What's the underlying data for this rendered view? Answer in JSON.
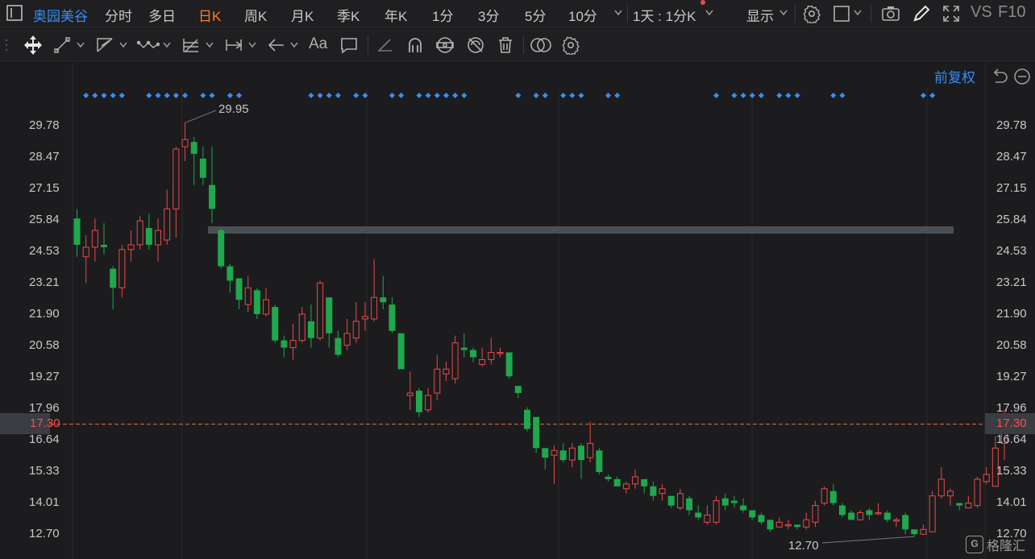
{
  "toolbar": {
    "stock_name": "奥园美谷",
    "periods": [
      "分时",
      "多日",
      "日K",
      "周K",
      "月K",
      "季K",
      "年K",
      "1分",
      "3分",
      "5分",
      "10分"
    ],
    "active_period": "日K",
    "interval_selector": "1天 : 1分K",
    "display_label": "显示",
    "vs_label": "VS",
    "f10_label": "F10"
  },
  "chart": {
    "restore_label": "前复权",
    "y_ticks": [
      "29.78",
      "28.47",
      "27.15",
      "25.84",
      "24.53",
      "23.21",
      "21.90",
      "20.58",
      "19.27",
      "17.96",
      "16.64",
      "15.33",
      "14.01",
      "12.70"
    ],
    "current_price": "17.30",
    "high_label": "29.95",
    "low_label": "12.70",
    "watermark": "格隆汇",
    "up_color": "#e84a4a",
    "down_color": "#1fa84d",
    "marker_color": "#3b8cf0"
  },
  "chart_data": {
    "type": "candlestick",
    "ylim": [
      12.2,
      30.6
    ],
    "candles": [
      [
        25.9,
        24.8,
        26.3,
        24.3
      ],
      [
        24.3,
        24.7,
        25.2,
        23.2
      ],
      [
        24.7,
        25.4,
        25.9,
        24.1
      ],
      [
        24.8,
        24.7,
        25.7,
        24.4
      ],
      [
        23.8,
        23.0,
        23.9,
        22.1
      ],
      [
        23.0,
        24.6,
        24.8,
        22.6
      ],
      [
        24.6,
        24.8,
        25.4,
        24.1
      ],
      [
        24.8,
        25.8,
        26.0,
        24.6
      ],
      [
        25.5,
        24.8,
        26.1,
        24.6
      ],
      [
        24.8,
        25.4,
        25.9,
        24.1
      ],
      [
        25.0,
        26.3,
        27.1,
        24.8
      ],
      [
        26.3,
        28.8,
        28.9,
        25.1
      ],
      [
        28.9,
        29.2,
        29.9,
        28.3
      ],
      [
        29.1,
        28.6,
        29.3,
        27.3
      ],
      [
        28.4,
        27.6,
        28.9,
        27.3
      ],
      [
        27.3,
        26.3,
        28.9,
        25.7
      ],
      [
        25.4,
        23.9,
        25.5,
        23.8
      ],
      [
        23.9,
        23.3,
        24.0,
        22.8
      ],
      [
        23.4,
        22.5,
        23.4,
        22.1
      ],
      [
        22.3,
        23.0,
        23.5,
        22.0
      ],
      [
        22.9,
        21.9,
        23.0,
        21.7
      ],
      [
        21.9,
        22.5,
        23.0,
        21.8
      ],
      [
        22.2,
        20.8,
        22.3,
        20.7
      ],
      [
        20.8,
        20.5,
        21.0,
        20.1
      ],
      [
        20.5,
        20.8,
        21.5,
        20.0
      ],
      [
        20.8,
        21.9,
        22.2,
        20.7
      ],
      [
        21.6,
        20.9,
        22.3,
        20.5
      ],
      [
        20.9,
        23.2,
        23.3,
        20.8
      ],
      [
        22.6,
        21.1,
        22.6,
        20.5
      ],
      [
        20.9,
        20.2,
        21.2,
        20.1
      ],
      [
        20.6,
        21.1,
        21.7,
        20.4
      ],
      [
        20.9,
        21.6,
        22.4,
        20.7
      ],
      [
        21.7,
        21.8,
        22.4,
        21.2
      ],
      [
        21.7,
        22.6,
        24.2,
        21.6
      ],
      [
        22.6,
        22.4,
        23.5,
        22.1
      ],
      [
        22.3,
        21.2,
        22.6,
        21.1
      ],
      [
        21.1,
        19.6,
        21.1,
        19.6
      ],
      [
        18.5,
        18.6,
        19.5,
        17.9
      ],
      [
        18.7,
        17.8,
        18.8,
        17.6
      ],
      [
        17.9,
        18.5,
        18.8,
        17.8
      ],
      [
        18.6,
        19.6,
        20.2,
        18.3
      ],
      [
        19.4,
        19.6,
        19.9,
        19.1
      ],
      [
        19.2,
        20.7,
        21.0,
        19.0
      ],
      [
        20.5,
        20.4,
        21.1,
        20.1
      ],
      [
        20.4,
        20.1,
        20.5,
        19.9
      ],
      [
        19.8,
        20.0,
        20.5,
        19.7
      ],
      [
        20.0,
        20.3,
        20.9,
        19.8
      ],
      [
        20.3,
        20.3,
        20.5,
        20.1
      ],
      [
        20.3,
        19.3,
        20.3,
        19.2
      ],
      [
        18.9,
        18.6,
        18.9,
        18.4
      ],
      [
        17.9,
        17.1,
        18.0,
        17.0
      ],
      [
        17.6,
        16.3,
        17.6,
        16.1
      ],
      [
        16.3,
        15.9,
        16.3,
        15.4
      ],
      [
        16.0,
        16.2,
        16.4,
        14.8
      ],
      [
        16.2,
        15.8,
        16.5,
        15.7
      ],
      [
        15.8,
        16.3,
        16.5,
        15.5
      ],
      [
        16.4,
        15.8,
        16.5,
        15.0
      ],
      [
        15.9,
        16.5,
        17.4,
        15.7
      ],
      [
        16.2,
        15.3,
        16.3,
        15.2
      ],
      [
        15.1,
        15.0,
        15.2,
        14.9
      ],
      [
        15.0,
        14.7,
        15.1,
        14.7
      ],
      [
        14.6,
        14.8,
        14.9,
        14.4
      ],
      [
        14.8,
        15.1,
        15.4,
        14.6
      ],
      [
        15.0,
        14.7,
        15.0,
        14.4
      ],
      [
        14.7,
        14.3,
        14.9,
        14.1
      ],
      [
        14.4,
        14.6,
        14.8,
        14.1
      ],
      [
        14.3,
        13.9,
        14.3,
        13.8
      ],
      [
        13.8,
        14.4,
        14.6,
        13.7
      ],
      [
        14.2,
        13.7,
        14.3,
        13.5
      ],
      [
        13.6,
        13.4,
        13.9,
        13.3
      ],
      [
        13.2,
        13.5,
        13.9,
        13.1
      ],
      [
        13.2,
        14.1,
        14.3,
        13.1
      ],
      [
        14.2,
        13.9,
        14.4,
        13.7
      ],
      [
        14.1,
        14.0,
        14.3,
        13.8
      ],
      [
        13.9,
        13.7,
        14.2,
        13.6
      ],
      [
        13.7,
        13.4,
        13.7,
        13.3
      ],
      [
        13.5,
        13.2,
        13.6,
        13.1
      ],
      [
        13.3,
        12.9,
        13.3,
        12.8
      ],
      [
        13.0,
        13.2,
        13.4,
        13.0
      ],
      [
        13.1,
        13.1,
        13.3,
        12.9
      ],
      [
        13.1,
        13.0,
        13.1,
        12.9
      ],
      [
        13.0,
        13.3,
        13.6,
        12.9
      ],
      [
        13.2,
        13.9,
        14.1,
        13.0
      ],
      [
        14.0,
        14.6,
        14.7,
        13.9
      ],
      [
        14.5,
        14.0,
        14.8,
        13.9
      ],
      [
        13.9,
        13.5,
        14.0,
        13.4
      ],
      [
        13.6,
        13.3,
        13.7,
        13.3
      ],
      [
        13.3,
        13.6,
        13.7,
        13.3
      ],
      [
        13.7,
        13.5,
        13.8,
        13.3
      ],
      [
        13.6,
        13.6,
        14.0,
        13.5
      ],
      [
        13.6,
        13.3,
        13.7,
        13.2
      ],
      [
        13.3,
        13.3,
        13.4,
        13.0
      ],
      [
        13.5,
        12.9,
        13.6,
        12.7
      ],
      [
        12.9,
        12.7,
        12.9,
        12.6
      ],
      [
        12.7,
        12.9,
        13.1,
        12.7
      ],
      [
        12.8,
        14.3,
        14.5,
        12.8
      ],
      [
        14.3,
        15.0,
        15.5,
        14.2
      ],
      [
        14.3,
        14.5,
        14.6,
        13.9
      ],
      [
        14.0,
        13.9,
        14.0,
        13.7
      ],
      [
        13.8,
        14.0,
        14.3,
        13.8
      ],
      [
        13.9,
        15.0,
        15.1,
        13.8
      ],
      [
        14.9,
        15.2,
        15.5,
        14.8
      ],
      [
        14.7,
        16.3,
        16.8,
        14.7
      ],
      [
        16.5,
        17.4,
        17.9,
        15.8
      ]
    ],
    "dot_groups": [
      [
        1,
        5
      ],
      [
        8,
        12
      ],
      [
        14,
        15
      ],
      [
        17,
        18
      ],
      [
        26,
        29
      ],
      [
        31,
        32
      ],
      [
        35,
        36
      ],
      [
        38,
        43
      ],
      [
        49,
        49
      ],
      [
        51,
        52
      ],
      [
        54,
        56
      ],
      [
        59,
        60
      ],
      [
        71,
        71
      ],
      [
        73,
        76
      ],
      [
        78,
        80
      ],
      [
        84,
        85
      ],
      [
        94,
        95
      ]
    ]
  }
}
